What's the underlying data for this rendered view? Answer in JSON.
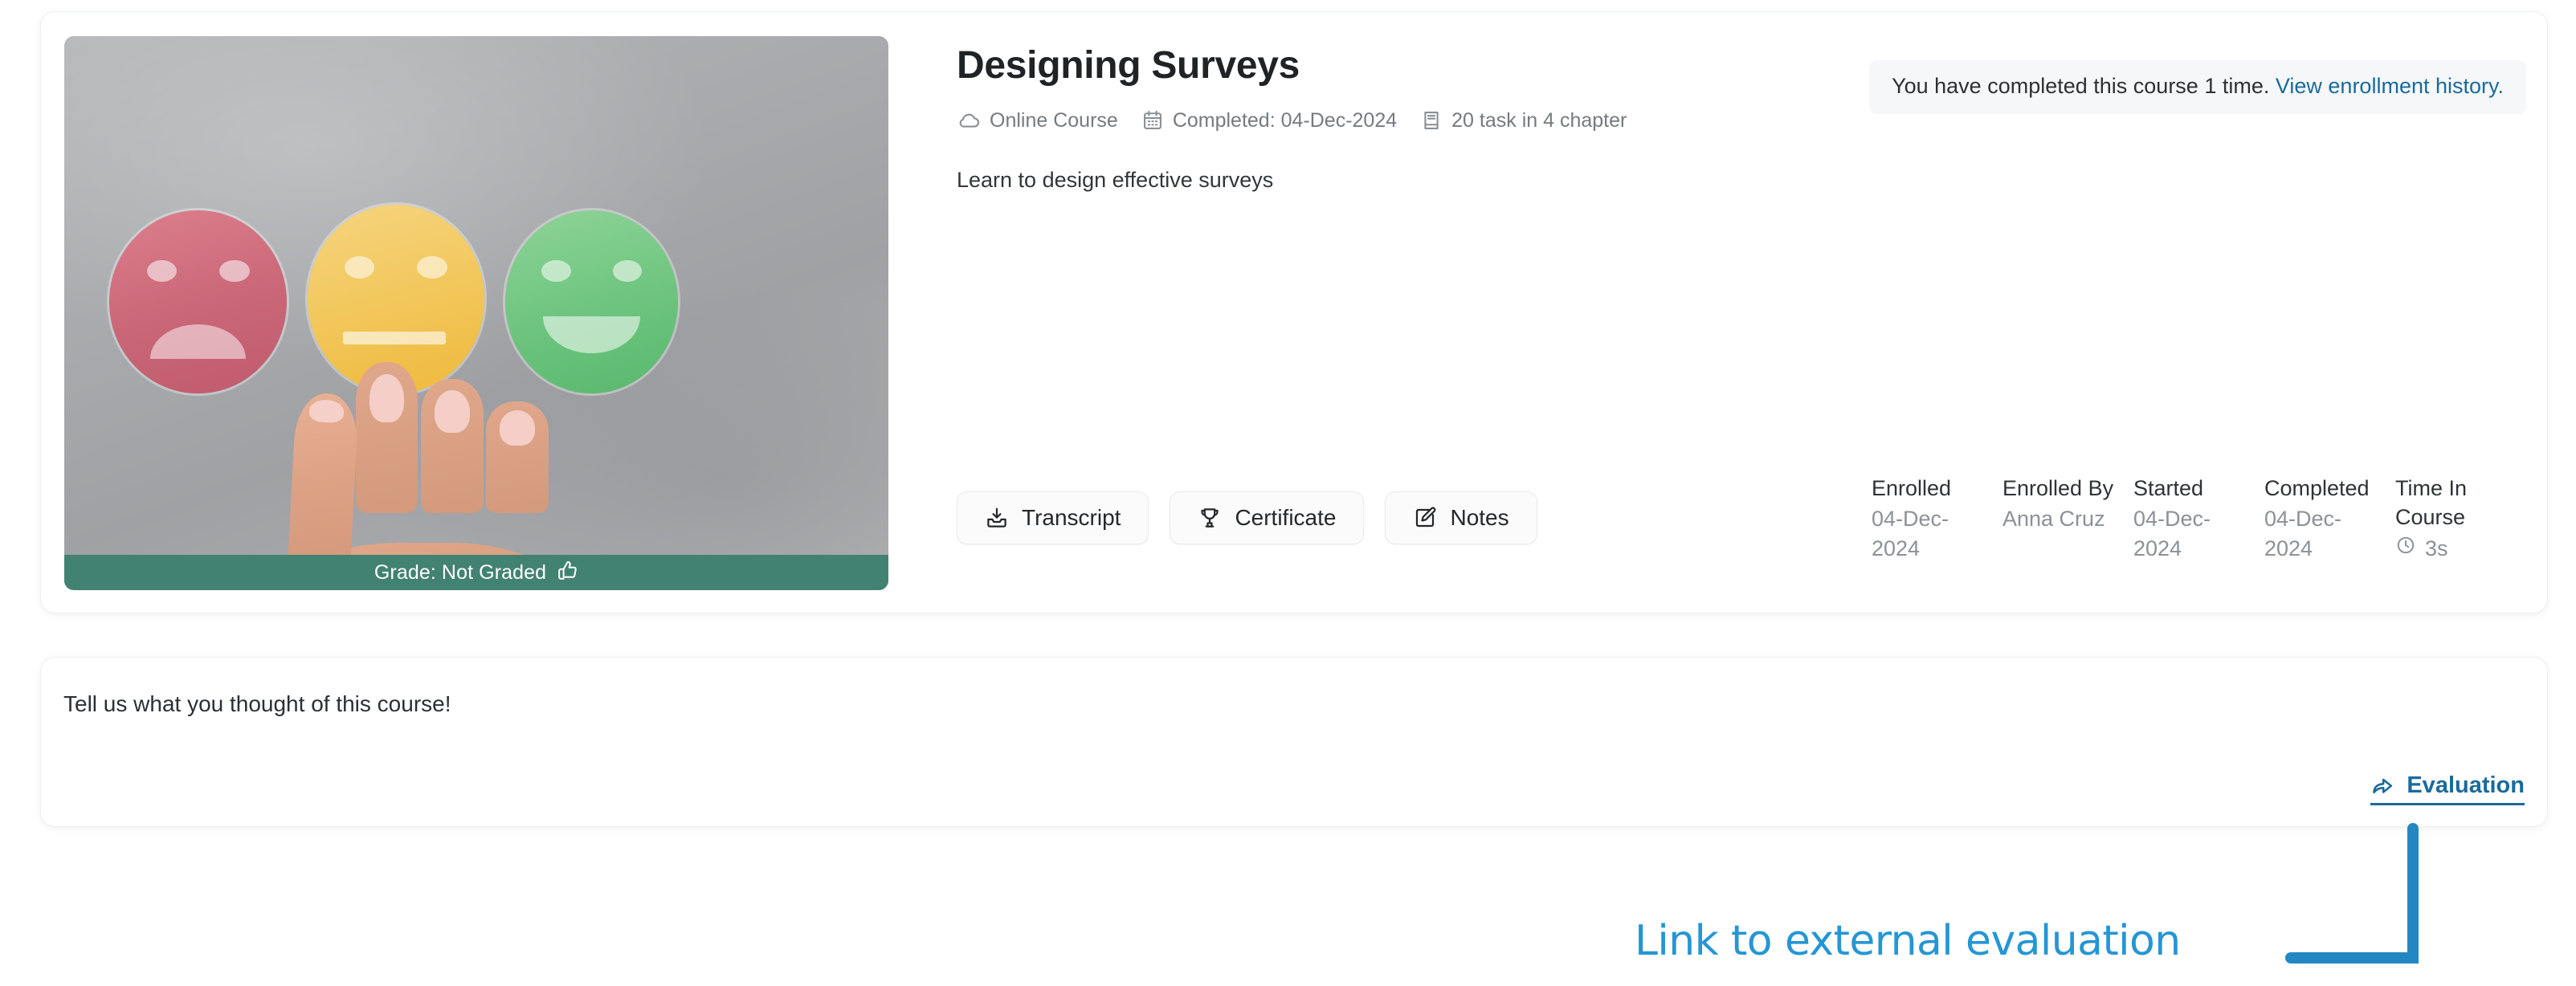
{
  "course": {
    "title": "Designing Surveys",
    "description": "Learn to design effective surveys",
    "meta": [
      {
        "icon": "cloud-icon",
        "text": "Online Course"
      },
      {
        "icon": "calendar-icon",
        "text": "Completed: 04-Dec-2024"
      },
      {
        "icon": "book-icon",
        "text": "20 task in 4 chapter"
      }
    ],
    "grade_label": "Grade: Not Graded",
    "notice": {
      "text": "You have completed this course 1 time.",
      "link_text": "View enrollment history."
    },
    "buttons": [
      {
        "icon": "download-icon",
        "label": "Transcript"
      },
      {
        "icon": "trophy-icon",
        "label": "Certificate"
      },
      {
        "icon": "note-edit-icon",
        "label": "Notes"
      }
    ],
    "stats": [
      {
        "label": "Enrolled",
        "value": "04-Dec-2024",
        "icon": ""
      },
      {
        "label": "Enrolled By",
        "value": "Anna Cruz",
        "icon": ""
      },
      {
        "label": "Started",
        "value": "04-Dec-2024",
        "icon": ""
      },
      {
        "label": "Completed",
        "value": "04-Dec-2024",
        "icon": ""
      },
      {
        "label": "Time In Course",
        "value": "3s",
        "icon": "clock-icon"
      }
    ]
  },
  "evaluation": {
    "prompt": "Tell us what you thought of this course!",
    "link_label": "Evaluation",
    "link_icon": "share-arrow-icon"
  },
  "annotation": {
    "text": "Link to external evaluation",
    "color": "#2596d4"
  },
  "colors": {
    "accent_link": "#1b6a9c",
    "grade_bar": "#428272",
    "notice_bg": "#f6f7f8",
    "annotation": "#2596d4"
  }
}
